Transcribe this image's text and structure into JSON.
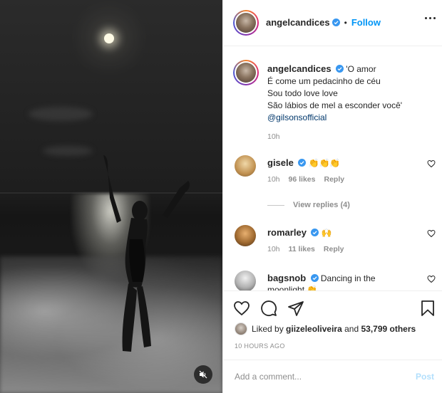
{
  "post": {
    "author": "angelcandices",
    "follow_label": "Follow",
    "separator": "•",
    "caption_lines": [
      "'O amor",
      "É come um pedacinho de céu",
      "Sou todo love love",
      "São lábios de mel a esconder você'"
    ],
    "caption_mention": "@gilsonsofficial",
    "caption_time": "10h"
  },
  "comments": [
    {
      "user": "gisele",
      "text": "👏👏👏",
      "time": "10h",
      "likes": "96 likes",
      "reply": "Reply"
    },
    {
      "user": "romarley",
      "text": "🙌",
      "time": "10h",
      "likes": "11 likes",
      "reply": "Reply"
    },
    {
      "user": "bagsnob",
      "text": "Dancing in the",
      "text2": "moonlight 👏"
    }
  ],
  "view_replies": "View replies (4)",
  "likes": {
    "prefix": "Liked by",
    "user": "giizeleoliveira",
    "connector": "and",
    "others": "53,799 others"
  },
  "timestamp": "10 HOURS AGO",
  "add_comment": {
    "placeholder": "Add a comment...",
    "post_label": "Post"
  },
  "colors": {
    "accent": "#0095f6",
    "verified": "#3897f0",
    "muted_text": "#8e8e8e"
  }
}
